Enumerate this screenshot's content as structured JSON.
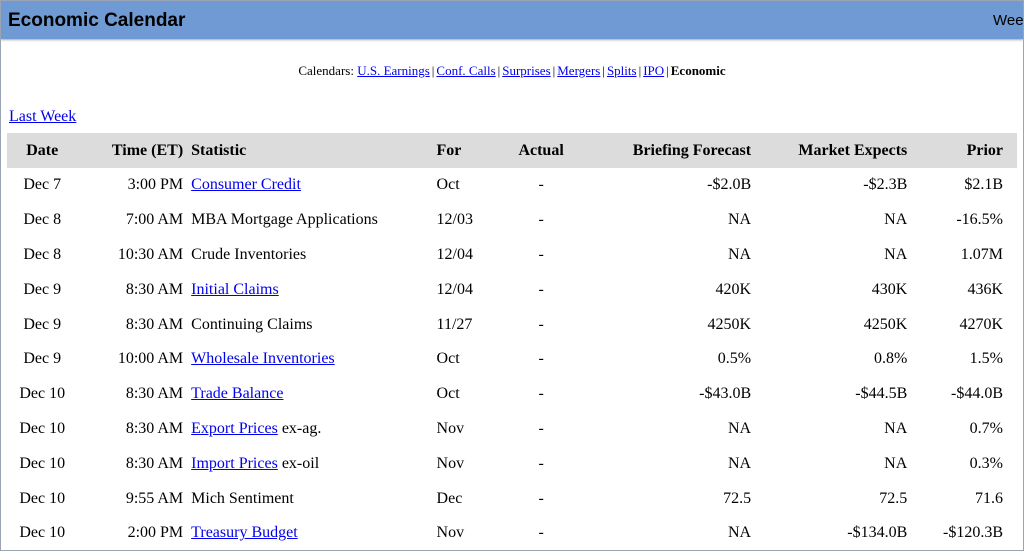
{
  "header": {
    "title": "Economic Calendar",
    "right_text": "Week"
  },
  "calendars": {
    "label": "Calendars:",
    "links": [
      "U.S. Earnings",
      "Conf. Calls",
      "Surprises",
      "Mergers",
      "Splits",
      "IPO"
    ],
    "current": "Economic"
  },
  "last_week": "Last Week",
  "columns": [
    "Date",
    "Time (ET)",
    "Statistic",
    "For",
    "Actual",
    "Briefing Forecast",
    "Market Expects",
    "Prior"
  ],
  "rows": [
    {
      "date": "Dec 7",
      "time": "3:00 PM",
      "stat": "Consumer Credit",
      "link": true,
      "suffix": "",
      "for": "Oct",
      "actual": "-",
      "briefing": "-$2.0B",
      "market": "-$2.3B",
      "prior": "$2.1B"
    },
    {
      "date": "Dec 8",
      "time": "7:00 AM",
      "stat": "MBA Mortgage Applications",
      "link": false,
      "suffix": "",
      "for": "12/03",
      "actual": "-",
      "briefing": "NA",
      "market": "NA",
      "prior": "-16.5%"
    },
    {
      "date": "Dec 8",
      "time": "10:30 AM",
      "stat": "Crude Inventories",
      "link": false,
      "suffix": "",
      "for": "12/04",
      "actual": "-",
      "briefing": "NA",
      "market": "NA",
      "prior": "1.07M"
    },
    {
      "date": "Dec 9",
      "time": "8:30 AM",
      "stat": "Initial Claims",
      "link": true,
      "suffix": "",
      "for": "12/04",
      "actual": "-",
      "briefing": "420K",
      "market": "430K",
      "prior": "436K"
    },
    {
      "date": "Dec 9",
      "time": "8:30 AM",
      "stat": "Continuing Claims",
      "link": false,
      "suffix": "",
      "for": "11/27",
      "actual": "-",
      "briefing": "4250K",
      "market": "4250K",
      "prior": "4270K"
    },
    {
      "date": "Dec 9",
      "time": "10:00 AM",
      "stat": "Wholesale Inventories",
      "link": true,
      "suffix": "",
      "for": "Oct",
      "actual": "-",
      "briefing": "0.5%",
      "market": "0.8%",
      "prior": "1.5%"
    },
    {
      "date": "Dec 10",
      "time": "8:30 AM",
      "stat": "Trade Balance",
      "link": true,
      "suffix": "",
      "for": "Oct",
      "actual": "-",
      "briefing": "-$43.0B",
      "market": "-$44.5B",
      "prior": "-$44.0B"
    },
    {
      "date": "Dec 10",
      "time": "8:30 AM",
      "stat": "Export Prices",
      "link": true,
      "suffix": " ex-ag.",
      "for": "Nov",
      "actual": "-",
      "briefing": "NA",
      "market": "NA",
      "prior": "0.7%"
    },
    {
      "date": "Dec 10",
      "time": "8:30 AM",
      "stat": "Import Prices",
      "link": true,
      "suffix": " ex-oil",
      "for": "Nov",
      "actual": "-",
      "briefing": "NA",
      "market": "NA",
      "prior": "0.3%"
    },
    {
      "date": "Dec 10",
      "time": "9:55 AM",
      "stat": "Mich Sentiment",
      "link": false,
      "suffix": "",
      "for": "Dec",
      "actual": "-",
      "briefing": "72.5",
      "market": "72.5",
      "prior": "71.6"
    },
    {
      "date": "Dec 10",
      "time": "2:00 PM",
      "stat": "Treasury Budget",
      "link": true,
      "suffix": "",
      "for": "Nov",
      "actual": "-",
      "briefing": "NA",
      "market": "-$134.0B",
      "prior": "-$120.3B"
    }
  ],
  "colors": {
    "header_bg": "#6f9ad3",
    "table_header_bg": "#dcdcdc",
    "link": "#0000ee"
  }
}
